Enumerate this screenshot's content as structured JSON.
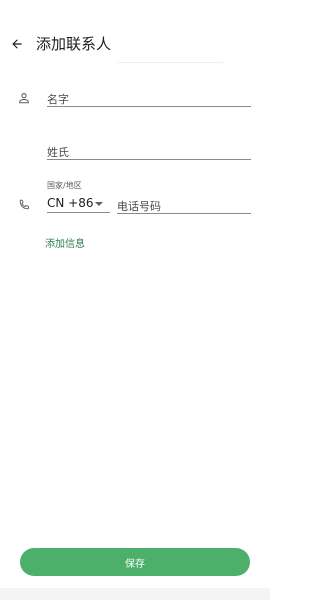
{
  "header": {
    "title": "添加联系人"
  },
  "form": {
    "first_name": {
      "placeholder": "名字",
      "value": ""
    },
    "last_name": {
      "placeholder": "姓氏",
      "value": ""
    },
    "phone": {
      "country_label": "国家/地区",
      "country_value": "CN +86",
      "placeholder": "电话号码",
      "value": ""
    },
    "add_info_label": "添加信息"
  },
  "footer": {
    "save_label": "保存"
  },
  "colors": {
    "accent": "#4caf6a",
    "link": "#2e7d4f"
  },
  "icons": [
    "back-arrow-icon",
    "person-icon",
    "phone-icon",
    "chevron-down-icon"
  ]
}
